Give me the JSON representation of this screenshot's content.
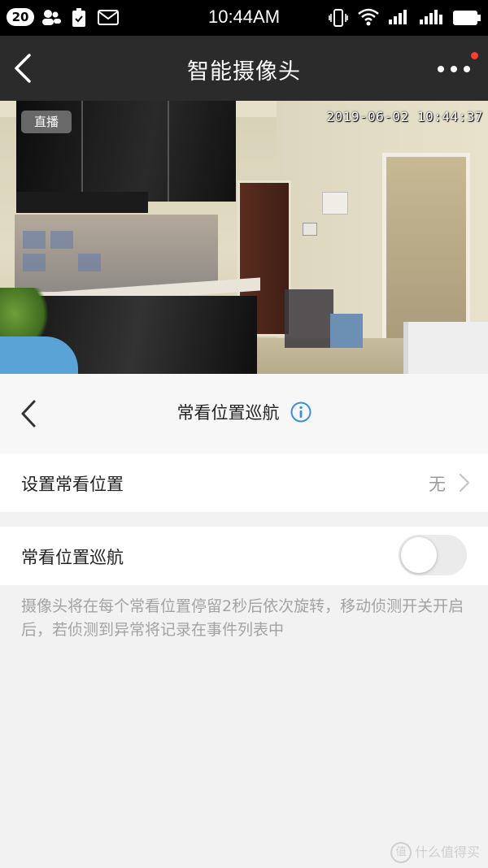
{
  "status_bar": {
    "badge": "20",
    "time": "10:44AM"
  },
  "header": {
    "title": "智能摄像头"
  },
  "feed": {
    "live_badge": "直播",
    "timestamp": "2019-06-02 10:44:37"
  },
  "sub_header": {
    "title": "常看位置巡航"
  },
  "rows": {
    "set_position_label": "设置常看位置",
    "set_position_value": "无",
    "cruise_label": "常看位置巡航",
    "cruise_enabled": false
  },
  "description": "摄像头将在每个常看位置停留2秒后依次旋转，移动侦测开关开启后，若侦测到异常将记录在事件列表中",
  "watermark": {
    "logo": "值",
    "text": "什么值得买"
  },
  "icons": {
    "status": [
      "contacts-icon",
      "battery-saver-icon",
      "mail-icon",
      "vibrate-icon",
      "wifi-icon",
      "signal-icon",
      "signal-r-icon",
      "battery-icon"
    ],
    "header": [
      "back-arrow-icon",
      "more-icon"
    ],
    "sub_header": [
      "back-arrow-icon",
      "info-icon"
    ],
    "row": [
      "chevron-right-icon"
    ]
  },
  "colors": {
    "header_bg": "#2b2b2b",
    "notification_dot": "#ff3b30",
    "info_icon": "#3a8ee6",
    "toggle_off": "#ebebeb"
  }
}
